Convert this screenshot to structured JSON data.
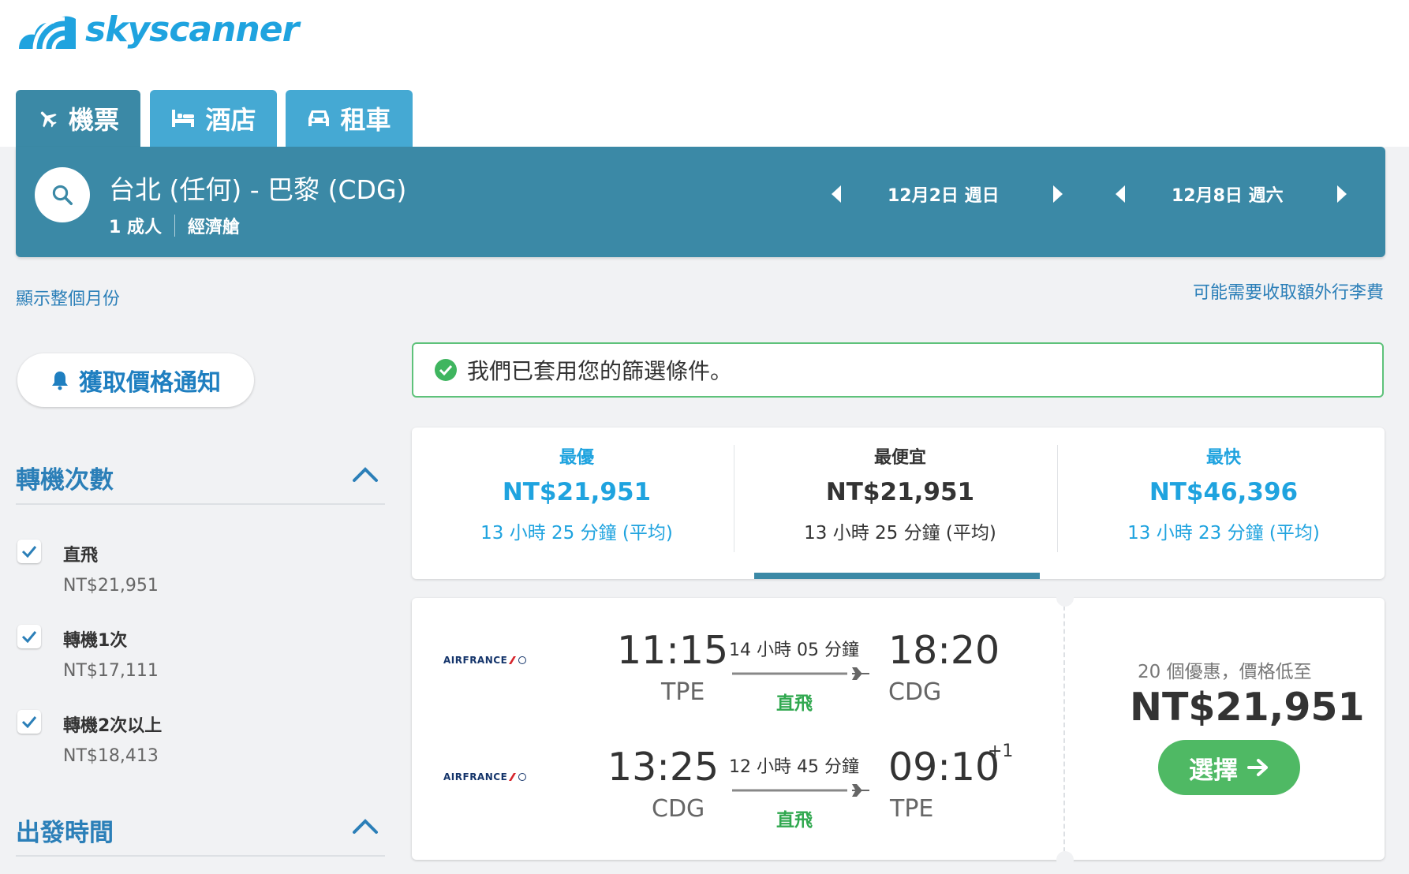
{
  "brand": {
    "name": "skyscanner"
  },
  "tabs": [
    {
      "label": "機票",
      "icon": "plane-icon",
      "active": true
    },
    {
      "label": "酒店",
      "icon": "bed-icon",
      "active": false
    },
    {
      "label": "租車",
      "icon": "car-icon",
      "active": false
    }
  ],
  "search": {
    "route": "台北 (任何) - 巴黎 (CDG)",
    "passengers": "1 成人",
    "cabin": "經濟艙",
    "depart_date": "12月2日 週日",
    "return_date": "12月8日 週六"
  },
  "links": {
    "show_month": "顯示整個月份",
    "baggage_fee": "可能需要收取額外行李費"
  },
  "price_alert": {
    "label": "獲取價格通知"
  },
  "filters": {
    "stops": {
      "title": "轉機次數",
      "options": [
        {
          "label": "直飛",
          "price": "NT$21,951",
          "checked": true
        },
        {
          "label": "轉機1次",
          "price": "NT$17,111",
          "checked": true
        },
        {
          "label": "轉機2次以上",
          "price": "NT$18,413",
          "checked": true
        }
      ]
    },
    "departure_time": {
      "title": "出發時間"
    }
  },
  "banner": {
    "text": "我們已套用您的篩選條件。"
  },
  "sort": [
    {
      "label": "最優",
      "price": "NT$21,951",
      "duration": "13 小時 25 分鐘 (平均)",
      "selected": false
    },
    {
      "label": "最便宜",
      "price": "NT$21,951",
      "duration": "13 小時 25 分鐘 (平均)",
      "selected": true
    },
    {
      "label": "最快",
      "price": "NT$46,396",
      "duration": "13 小時 23 分鐘 (平均)",
      "selected": false
    }
  ],
  "result": {
    "legs": [
      {
        "airline": "AIRFRANCE",
        "depart_time": "11:15",
        "depart_code": "TPE",
        "duration": "14 小時 05 分鐘",
        "stops": "直飛",
        "arrive_time": "18:20",
        "arrive_code": "CDG",
        "day_offset": ""
      },
      {
        "airline": "AIRFRANCE",
        "depart_time": "13:25",
        "depart_code": "CDG",
        "duration": "12 小時 45 分鐘",
        "stops": "直飛",
        "arrive_time": "09:10",
        "arrive_code": "TPE",
        "day_offset": "+1"
      }
    ],
    "deals": "20 個優惠，價格低至",
    "price": "NT$21,951",
    "select_label": "選擇"
  },
  "colors": {
    "accent": "#3b89a6",
    "tab_inactive": "#45a9d3",
    "link": "#2b7fb8",
    "success": "#5ec27a",
    "select": "#4fb964",
    "sort_highlight": "#1fa3df",
    "background": "#f1f2f4"
  }
}
